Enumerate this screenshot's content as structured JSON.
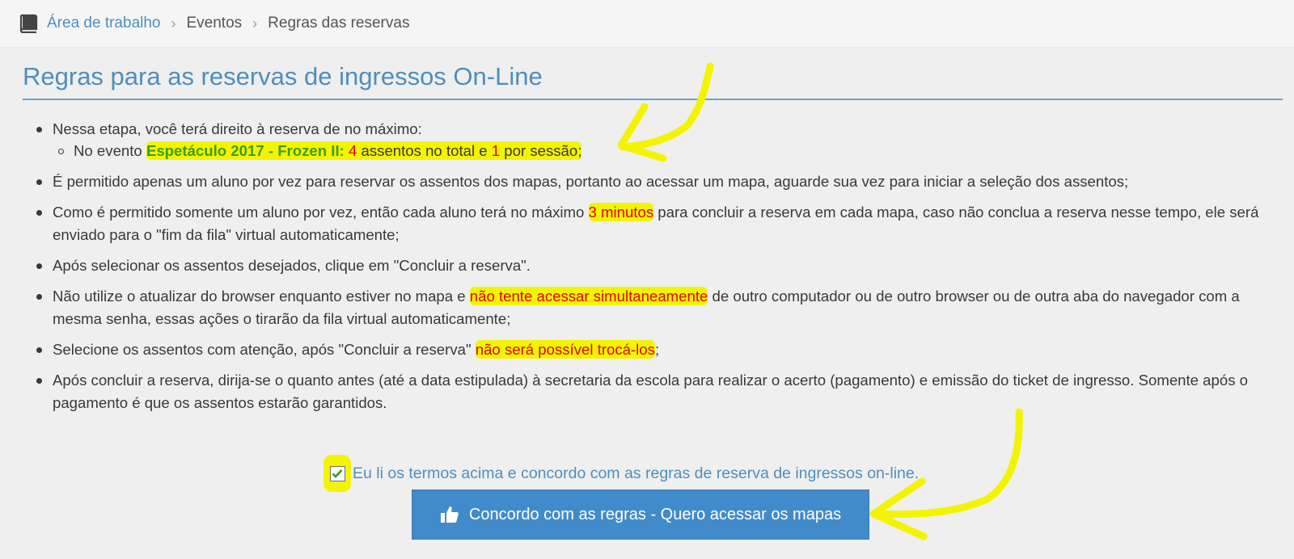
{
  "breadcrumb": {
    "home": "Área de trabalho",
    "events": "Eventos",
    "current": "Regras das reservas",
    "home_icon": "book-icon",
    "separator_icon": "chevron-right-icon"
  },
  "page_title": "Regras para as reservas de ingressos On-Line",
  "rules": {
    "r1_text": "Nessa etapa, você terá direito à reserva de no máximo:",
    "r1_sub_prefix": "No evento ",
    "r1_sub_event": "Espetáculo 2017 - Frozen II:",
    "r1_sub_space1": " ",
    "r1_sub_total": "4",
    "r1_sub_mid": " assentos no total e ",
    "r1_sub_session": "1",
    "r1_sub_suffix": " por sessão;",
    "r2_text": "É permitido apenas um aluno por vez para reservar os assentos dos mapas, portanto ao acessar um mapa, aguarde sua vez para iniciar a seleção dos assentos;",
    "r3_before": "Como é permitido somente um aluno por vez, então cada aluno terá no máximo ",
    "r3_highlight": "3 minutos",
    "r3_after": " para concluir a reserva em cada mapa, caso não conclua a reserva nesse tempo, ele será enviado para o \"fim da fila\" virtual automaticamente;",
    "r4_text": "Após selecionar os assentos desejados, clique em \"Concluir a reserva\".",
    "r5_before": "Não utilize o atualizar do browser enquanto estiver no mapa e ",
    "r5_highlight": "não tente acessar simultaneamente",
    "r5_after": " de outro computador ou de outro browser ou de outra aba do navegador com a mesma senha, essas ações o tirarão da fila virtual automaticamente;",
    "r6_before": "Selecione os assentos com atenção, após \"Concluir a reserva\" ",
    "r6_highlight": "não será possível trocá-los",
    "r6_after": ";",
    "r7_text": "Após concluir a reserva, dirija-se o quanto antes (até a data estipulada) à secretaria da escola para realizar o acerto (pagamento) e emissão do ticket de ingresso. Somente após o pagamento é que os assentos estarão garantidos."
  },
  "agree": {
    "label": "Eu li os termos acima e concordo com as regras de reserva de ingressos on-line.",
    "checked": true,
    "icon": "checkmark-icon"
  },
  "button": {
    "label": "Concordo com as regras - Quero acessar os mapas",
    "icon": "thumbs-up-icon"
  },
  "colors": {
    "accent": "#4c8fbd",
    "button": "#428bca",
    "highlight": "#f4f400",
    "event_name": "#3d9d10",
    "emphasis": "#e60000"
  }
}
